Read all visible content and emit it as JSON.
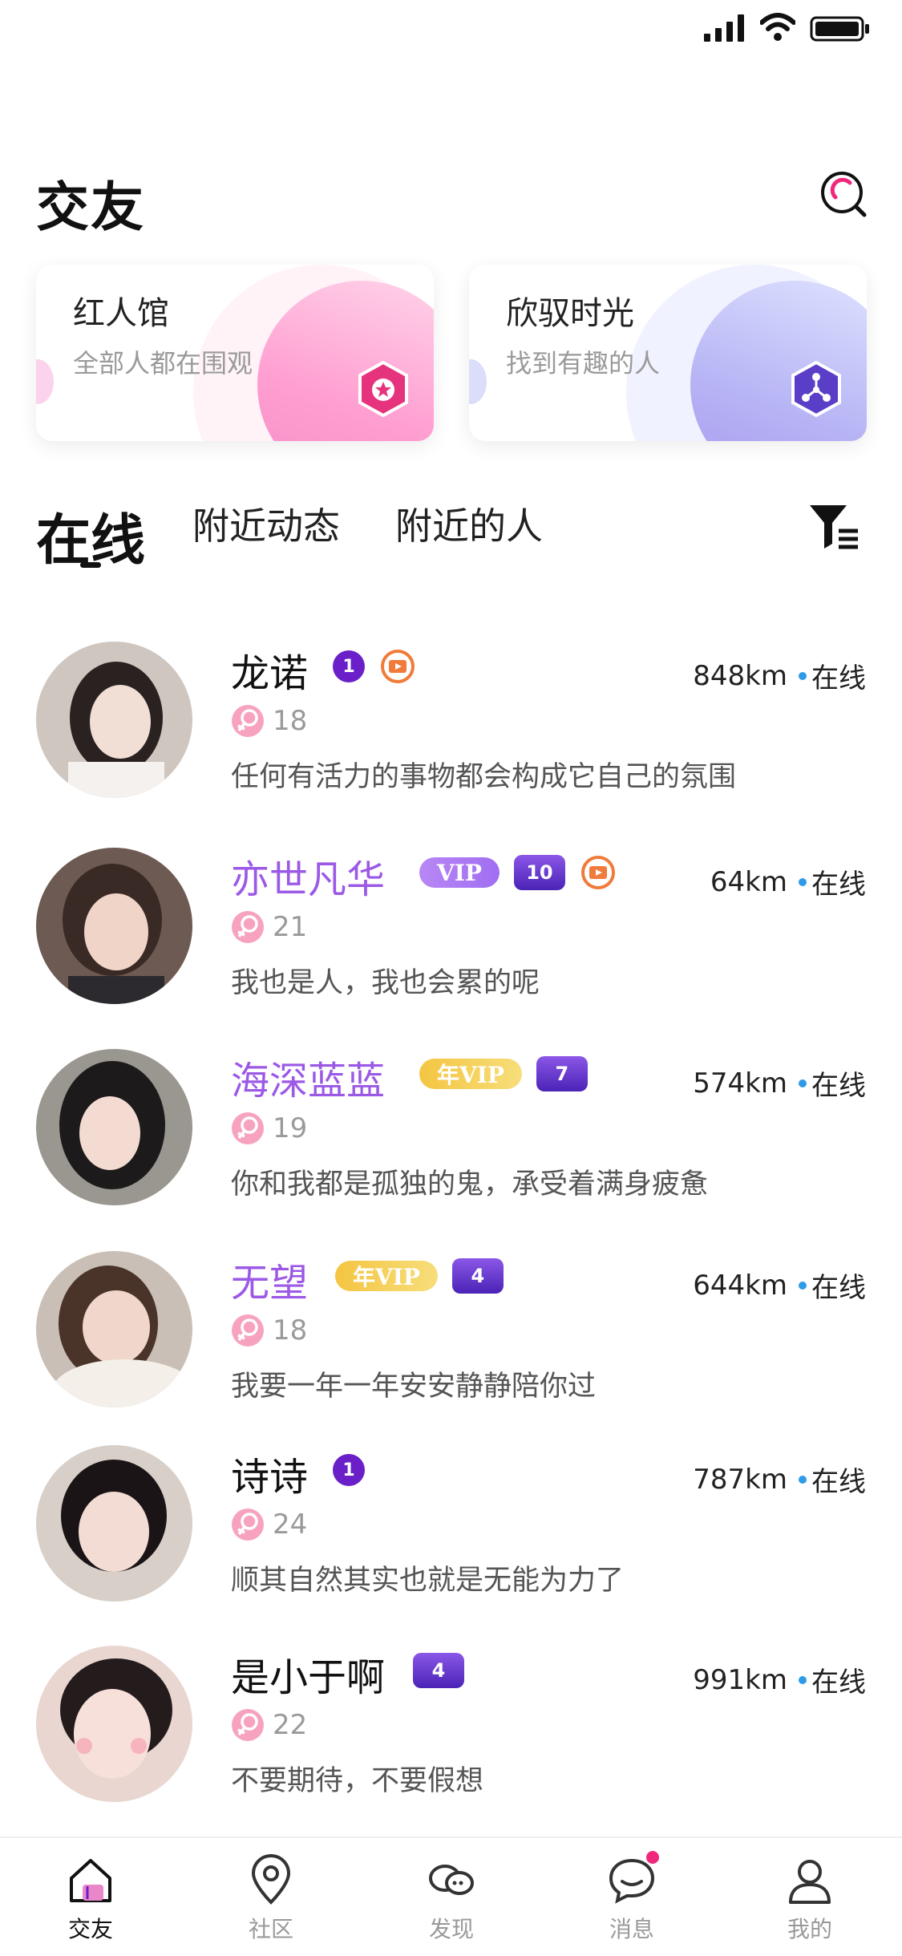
{
  "header": {
    "title": "交友"
  },
  "cards": [
    {
      "title": "红人馆",
      "subtitle": "全部人都在围观",
      "icon": "medal-icon"
    },
    {
      "title": "欣驭时光",
      "subtitle": "找到有趣的人",
      "icon": "network-icon"
    }
  ],
  "tabs": [
    {
      "label": "在线",
      "active": true
    },
    {
      "label": "附近动态",
      "active": false
    },
    {
      "label": "附近的人",
      "active": false
    }
  ],
  "users": [
    {
      "name": "龙诺",
      "name_style": "plain",
      "vip": "",
      "level": "1",
      "live": true,
      "age": "18",
      "distance": "848km",
      "status": "在线",
      "bio": "任何有活力的事物都会构成它自己的氛围"
    },
    {
      "name": "亦世凡华",
      "name_style": "vip",
      "vip": "VIP",
      "level": "10",
      "live": true,
      "age": "21",
      "distance": "64km",
      "status": "在线",
      "bio": "我也是人，我也会累的呢"
    },
    {
      "name": "海深蓝蓝",
      "name_style": "vip",
      "vip": "年VIP",
      "level": "7",
      "live": false,
      "age": "19",
      "distance": "574km",
      "status": "在线",
      "bio": "你和我都是孤独的鬼，承受着满身疲惫"
    },
    {
      "name": "无望",
      "name_style": "vip",
      "vip": "年VIP",
      "level": "4",
      "live": false,
      "age": "18",
      "distance": "644km",
      "status": "在线",
      "bio": "我要一年一年安安静静陪你过"
    },
    {
      "name": "诗诗",
      "name_style": "plain",
      "vip": "",
      "level": "1",
      "live": false,
      "age": "24",
      "distance": "787km",
      "status": "在线",
      "bio": "顺其自然其实也就是无能为力了"
    },
    {
      "name": "是小于啊",
      "name_style": "plain",
      "vip": "",
      "level": "4",
      "live": false,
      "age": "22",
      "distance": "991km",
      "status": "在线",
      "bio": "不要期待，不要假想"
    }
  ],
  "tabbar": [
    {
      "label": "交友",
      "icon": "home-icon",
      "active": true
    },
    {
      "label": "社区",
      "icon": "location-pin-icon",
      "active": false
    },
    {
      "label": "发现",
      "icon": "discover-icon",
      "active": false
    },
    {
      "label": "消息",
      "icon": "chat-bubble-icon",
      "active": false,
      "dot": true
    },
    {
      "label": "我的",
      "icon": "profile-icon",
      "active": false
    }
  ],
  "colors": {
    "vip_name": "#9b59e6",
    "level_badge": "#6a1fc8",
    "online_dot": "#2e9be8",
    "message_dot": "#f0287c",
    "gender_female": "#f36f97"
  }
}
